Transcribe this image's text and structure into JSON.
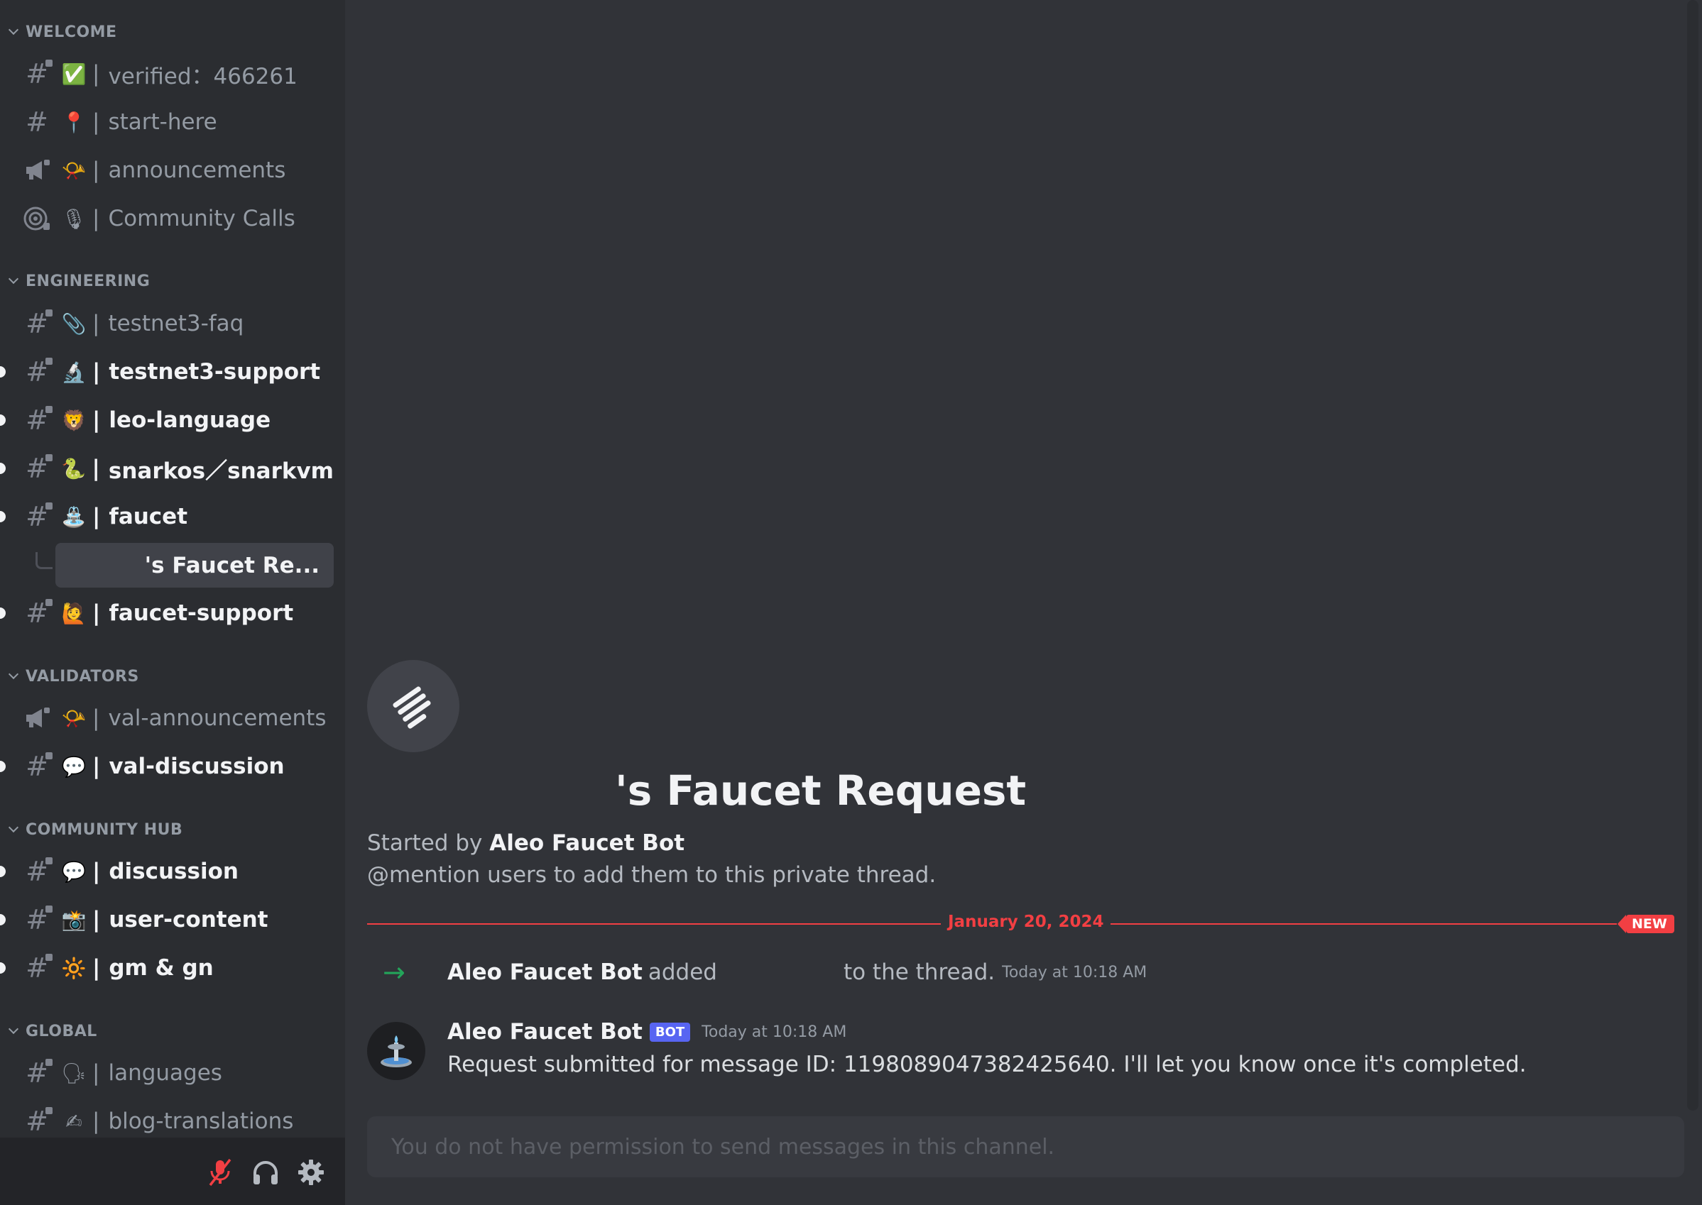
{
  "sidebar": {
    "categories": [
      {
        "label": "WELCOME"
      },
      {
        "label": "ENGINEERING"
      },
      {
        "label": "VALIDATORS"
      },
      {
        "label": "COMMUNITY HUB"
      },
      {
        "label": "GLOBAL"
      }
    ],
    "channels": [
      {
        "emoji": "✅",
        "name": "verified：466261",
        "icon": "hash-lock-icon",
        "unread": false
      },
      {
        "emoji": "📍",
        "name": "start-here",
        "icon": "hash-icon",
        "unread": false
      },
      {
        "emoji": "📯",
        "name": "announcements",
        "icon": "megaphone-lock-icon",
        "unread": false
      },
      {
        "emoji": "🎙",
        "name": "Community Calls",
        "icon": "stage-lock-icon",
        "unread": false
      },
      {
        "emoji": "📎",
        "name": "testnet3-faq",
        "icon": "hash-lock-icon",
        "unread": false
      },
      {
        "emoji": "🔬",
        "name": "testnet3-support",
        "icon": "hash-lock-icon",
        "unread": true
      },
      {
        "emoji": "🦁",
        "name": "leo-language",
        "icon": "hash-lock-icon",
        "unread": true
      },
      {
        "emoji": "🐍",
        "name": "snarkos／snarkvm",
        "icon": "hash-lock-icon",
        "unread": true
      },
      {
        "emoji": "⛲",
        "name": "faucet",
        "icon": "hash-lock-icon",
        "unread": true
      },
      {
        "emoji": "🙋",
        "name": "faucet-support",
        "icon": "hash-lock-icon",
        "unread": true
      },
      {
        "emoji": "📯",
        "name": "val-announcements",
        "icon": "megaphone-lock-icon",
        "unread": false
      },
      {
        "emoji": "💬",
        "name": "val-discussion",
        "icon": "hash-lock-icon",
        "unread": true
      },
      {
        "emoji": "💬",
        "name": "discussion",
        "icon": "hash-lock-icon",
        "unread": true
      },
      {
        "emoji": "📸",
        "name": "user-content",
        "icon": "hash-lock-icon",
        "unread": true
      },
      {
        "emoji": "🔆",
        "name": "gm & gn",
        "icon": "hash-lock-icon",
        "unread": true
      },
      {
        "emoji": "🗣",
        "name": "languages",
        "icon": "hash-lock-icon",
        "unread": false
      },
      {
        "emoji": "✍",
        "name": "blog-translations",
        "icon": "hash-lock-icon",
        "unread": false
      }
    ],
    "separator": "|",
    "active_thread": "'s Faucet Re..."
  },
  "userbar": {
    "icons": [
      "mic-muted-icon",
      "headphones-icon",
      "gear-icon"
    ]
  },
  "thread": {
    "title": "'s Faucet Request",
    "started_prefix": "Started by",
    "started_by": "Aleo Faucet Bot",
    "hint": "@mention users to add them to this private thread."
  },
  "divider": {
    "date": "January 20, 2024",
    "badge": "NEW"
  },
  "system_message": {
    "author": "Aleo Faucet Bot",
    "verb": "added",
    "suffix": "to the thread.",
    "timestamp": "Today at 10:18 AM"
  },
  "message": {
    "author": "Aleo Faucet Bot",
    "badge": "BOT",
    "timestamp": "Today at 10:18 AM",
    "text": "Request submitted for message ID: 1198089047382425640. I'll let you know once it's completed."
  },
  "composer": {
    "placeholder": "You do not have permission to send messages in this channel."
  },
  "colors": {
    "accent_red": "#f23f43",
    "bot_badge": "#5865f2",
    "join_arrow": "#23a55a"
  }
}
